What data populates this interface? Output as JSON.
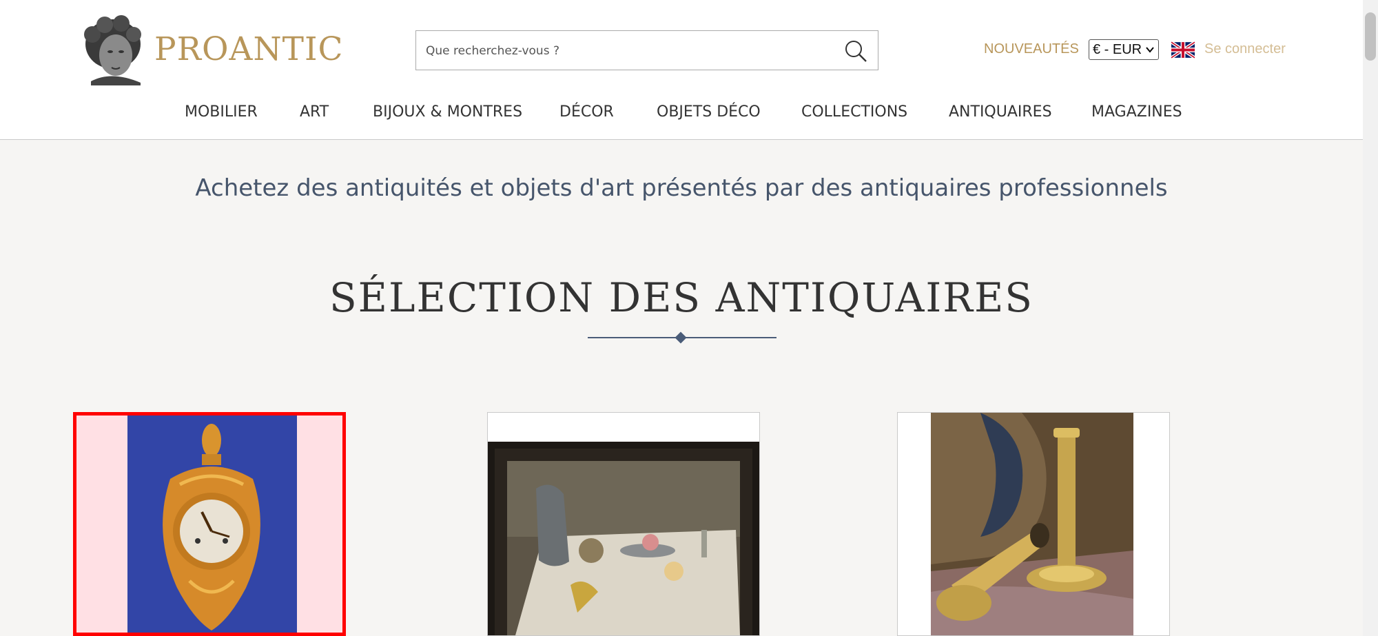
{
  "brand": {
    "name": "PROANTIC"
  },
  "search": {
    "placeholder": "Que recherchez-vous ?"
  },
  "header": {
    "new_label": "NOUVEAUTÉS",
    "currency": "€ - EUR",
    "login_label": "Se connecter"
  },
  "nav": {
    "items": [
      {
        "label": "MOBILIER"
      },
      {
        "label": "ART"
      },
      {
        "label": "BIJOUX & MONTRES"
      },
      {
        "label": "DÉCOR"
      },
      {
        "label": "OBJETS DÉCO"
      },
      {
        "label": "COLLECTIONS"
      },
      {
        "label": "ANTIQUAIRES"
      },
      {
        "label": "MAGAZINES"
      }
    ]
  },
  "main": {
    "tagline": "Achetez des antiquités et objets d'art présentés par des antiquaires professionnels",
    "section_title": "SÉLECTION DES ANTIQUAIRES",
    "cards": [
      {
        "icon": "cartel-clock-image",
        "highlighted": true
      },
      {
        "icon": "still-life-painting-image",
        "highlighted": false
      },
      {
        "icon": "candlesticks-image",
        "highlighted": false
      }
    ]
  },
  "colors": {
    "brand_gold": "#b8965a",
    "login_gold": "#d4bd94",
    "tagline_blue": "#46556b",
    "highlight_red": "#ff0000"
  }
}
